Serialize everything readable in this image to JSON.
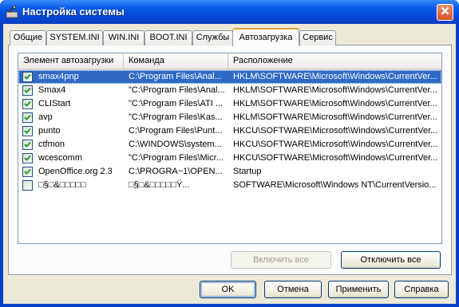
{
  "window": {
    "title": "Настройка системы"
  },
  "tabs": [
    {
      "label": "Общие",
      "active": false
    },
    {
      "label": "SYSTEM.INI",
      "active": false
    },
    {
      "label": "WIN.INI",
      "active": false
    },
    {
      "label": "BOOT.INI",
      "active": false
    },
    {
      "label": "Службы",
      "active": false
    },
    {
      "label": "Автозагрузка",
      "active": true
    },
    {
      "label": "Сервис",
      "active": false
    }
  ],
  "columns": [
    "Элемент автозагрузки",
    "Команда",
    "Расположение"
  ],
  "rows": [
    {
      "name": "smax4pnp",
      "command": "C:\\Program Files\\Anal...",
      "location": "HKLM\\SOFTWARE\\Microsoft\\Windows\\CurrentVer...",
      "checked": true,
      "selected": true
    },
    {
      "name": "Smax4",
      "command": "\"C:\\Program Files\\Anal...",
      "location": "HKLM\\SOFTWARE\\Microsoft\\Windows\\CurrentVer...",
      "checked": true,
      "selected": false
    },
    {
      "name": "CLIStart",
      "command": "\"C:\\Program Files\\ATI ...",
      "location": "HKLM\\SOFTWARE\\Microsoft\\Windows\\CurrentVer...",
      "checked": true,
      "selected": false
    },
    {
      "name": "avp",
      "command": "\"C:\\Program Files\\Kas...",
      "location": "HKLM\\SOFTWARE\\Microsoft\\Windows\\CurrentVer...",
      "checked": true,
      "selected": false
    },
    {
      "name": "punto",
      "command": "C:\\Program Files\\Punt...",
      "location": "HKCU\\SOFTWARE\\Microsoft\\Windows\\CurrentVer...",
      "checked": true,
      "selected": false
    },
    {
      "name": "ctfmon",
      "command": "C:\\WINDOWS\\system...",
      "location": "HKCU\\SOFTWARE\\Microsoft\\Windows\\CurrentVer...",
      "checked": true,
      "selected": false
    },
    {
      "name": "wcescomm",
      "command": "\"C:\\Program Files\\Micr...",
      "location": "HKCU\\SOFTWARE\\Microsoft\\Windows\\CurrentVer...",
      "checked": true,
      "selected": false
    },
    {
      "name": "OpenOffice.org 2.3",
      "command": "C:\\PROGRA~1\\OPEN...",
      "location": "Startup",
      "checked": true,
      "selected": false
    },
    {
      "name": "□§□&□□□□□",
      "command": "□§□&□□□□□Ÿ...",
      "location": "SOFTWARE\\Microsoft\\Windows NT\\CurrentVersio...",
      "checked": false,
      "selected": false
    }
  ],
  "list_buttons": {
    "enable_all": "Включить все",
    "disable_all": "Отключить все"
  },
  "dialog_buttons": {
    "ok": "OK",
    "cancel": "Отмена",
    "apply": "Применить",
    "help": "Справка"
  }
}
